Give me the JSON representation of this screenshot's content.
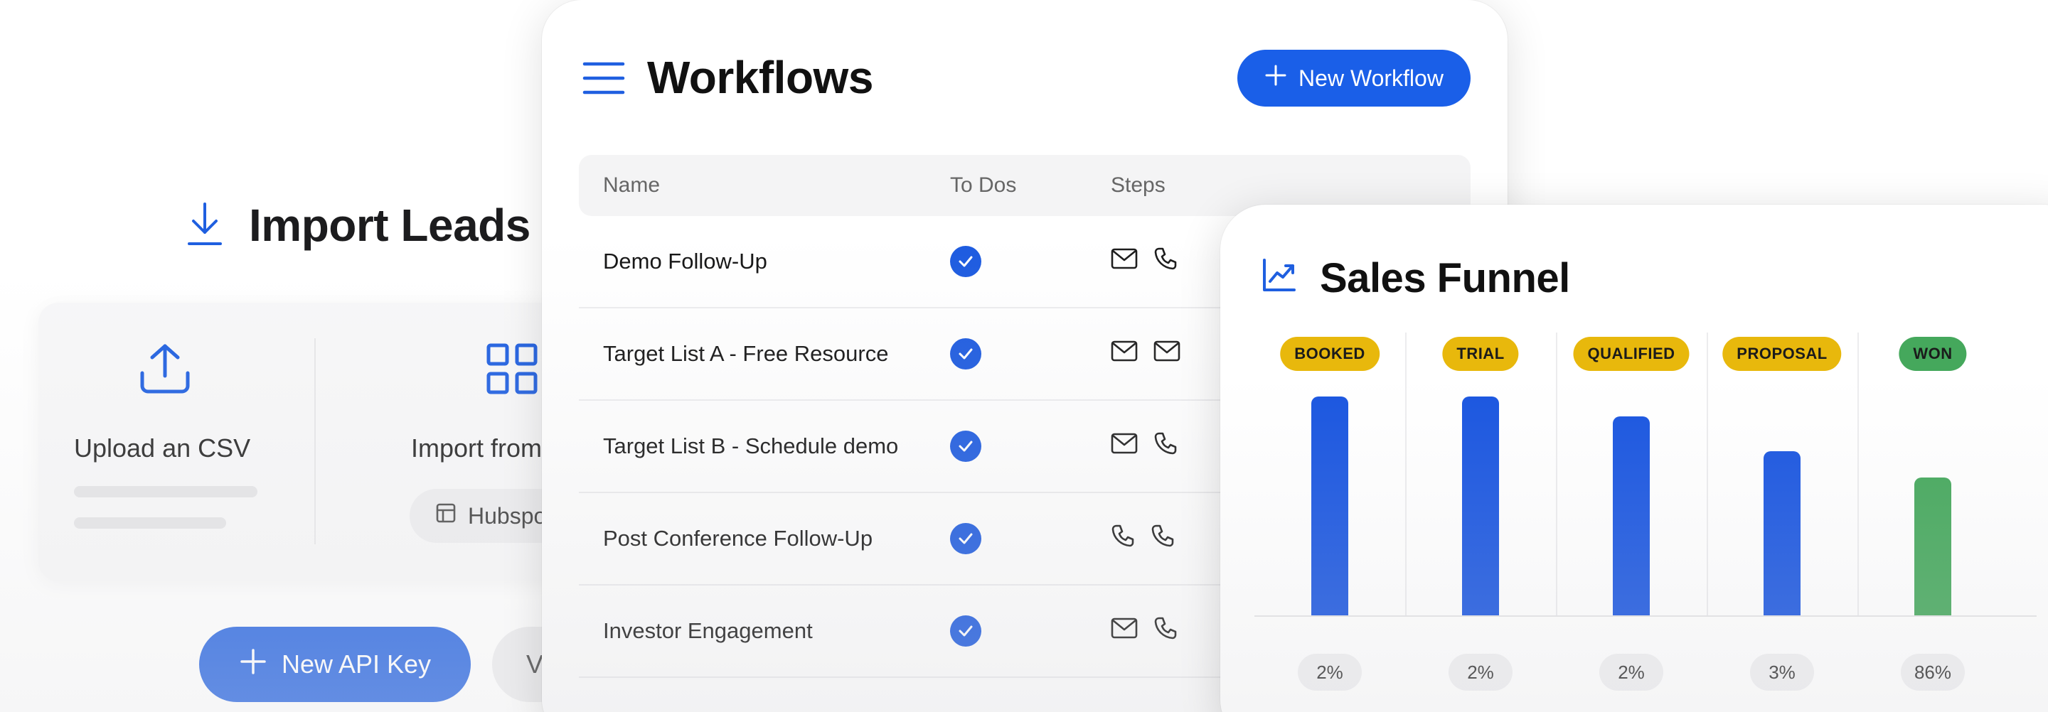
{
  "import_leads": {
    "title": "Import Leads",
    "upload_label": "Upload an CSV",
    "import_label": "Import from C",
    "crm_select": "Hubspot",
    "new_api_key_label": "New API Key",
    "secondary_button_label": "V"
  },
  "workflows": {
    "title": "Workflows",
    "new_button_label": "New Workflow",
    "columns": [
      "Name",
      "To Dos",
      "Steps"
    ],
    "rows": [
      {
        "name": "Demo Follow-Up",
        "todo": true,
        "steps": [
          "mail-icon",
          "phone-icon"
        ]
      },
      {
        "name": "Target List A - Free Resource",
        "todo": true,
        "steps": [
          "mail-icon",
          "mail-icon"
        ]
      },
      {
        "name": "Target List B - Schedule demo",
        "todo": true,
        "steps": [
          "mail-icon",
          "phone-icon"
        ]
      },
      {
        "name": "Post Conference Follow-Up",
        "todo": true,
        "steps": [
          "phone-icon",
          "phone-icon"
        ]
      },
      {
        "name": "Investor Engagement",
        "todo": true,
        "steps": [
          "mail-icon",
          "phone-icon"
        ]
      }
    ]
  },
  "sales_funnel": {
    "title": "Sales Funnel",
    "colors": {
      "yellow": "#e8b80c",
      "green": "#45a85c",
      "blue": "#1a56e0"
    }
  },
  "chart_data": {
    "type": "bar",
    "title": "Sales Funnel",
    "categories": [
      "BOOKED",
      "TRIAL",
      "QUALIFIED",
      "PROPOSAL",
      "WON"
    ],
    "values": [
      100,
      100,
      91,
      75,
      63
    ],
    "percent_labels": [
      "2%",
      "2%",
      "2%",
      "3%",
      "86%"
    ],
    "bar_colors": [
      "#1a56e0",
      "#1a56e0",
      "#1a56e0",
      "#1a56e0",
      "#45a85c"
    ],
    "badge_colors": [
      "#e8b80c",
      "#e8b80c",
      "#e8b80c",
      "#e8b80c",
      "#45a85c"
    ],
    "ylim": [
      0,
      100
    ],
    "grid": false
  }
}
